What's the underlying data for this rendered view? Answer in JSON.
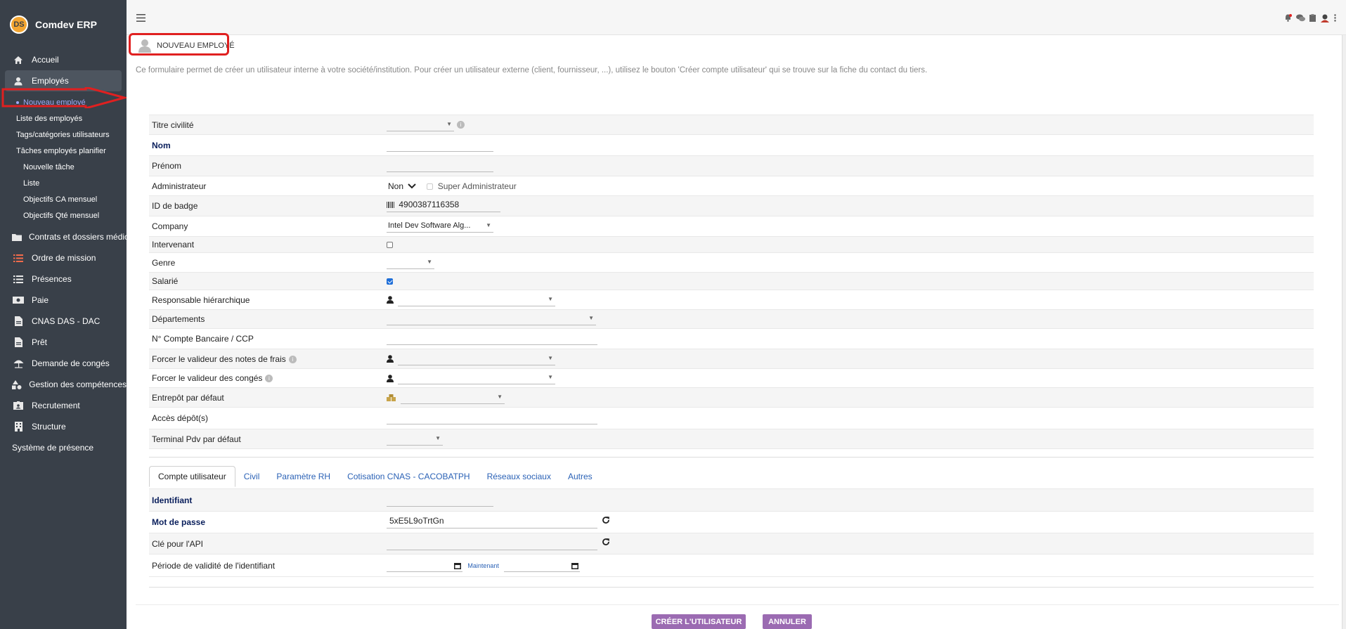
{
  "app": {
    "name": "Comdev ERP",
    "logo_text": "DS"
  },
  "sidebar": {
    "top_items": [
      {
        "label": "Accueil",
        "icon": "home-icon"
      },
      {
        "label": "Employés",
        "icon": "user-icon"
      }
    ],
    "employee_sub": {
      "current": "Nouveau employé",
      "items": [
        "Liste des employés",
        "Tags/catégories utilisateurs",
        "Tâches employés planifier"
      ],
      "lvl2": [
        "Nouvelle tâche",
        "Liste",
        "Objectifs CA mensuel",
        "Objectifs Qté mensuel"
      ]
    },
    "items": [
      {
        "label": "Contrats et dossiers médic",
        "icon": "folder-icon"
      },
      {
        "label": "Ordre de mission",
        "icon": "list-icon"
      },
      {
        "label": "Présences",
        "icon": "list-icon"
      },
      {
        "label": "Paie",
        "icon": "money-icon"
      },
      {
        "label": "CNAS DAS - DAC",
        "icon": "file-icon"
      },
      {
        "label": "Prêt",
        "icon": "file-icon"
      },
      {
        "label": "Demande de congés",
        "icon": "umbrella-icon"
      },
      {
        "label": "Gestion des compétences",
        "icon": "shapes-icon"
      },
      {
        "label": "Recrutement",
        "icon": "id-card-icon"
      },
      {
        "label": "Structure",
        "icon": "building-icon"
      }
    ],
    "bottom_item": "Système de présence"
  },
  "page": {
    "title": "NOUVEAU EMPLOYÉ",
    "description": "Ce formulaire permet de créer un utilisateur interne à votre société/institution. Pour créer un utilisateur externe (client, fournisseur, ...), utilisez le bouton 'Créer compte utilisateur' qui se trouve sur la fiche du contact du tiers."
  },
  "form": {
    "titre_civilite": "Titre civilité",
    "nom": "Nom",
    "prenom": "Prénom",
    "administrateur": "Administrateur",
    "administrateur_value": "Non",
    "super_admin": "Super Administrateur",
    "badge": "ID de badge",
    "badge_value": "4900387116358",
    "company": "Company",
    "company_value": "Intel Dev Software Alg...",
    "intervenant": "Intervenant",
    "genre": "Genre",
    "salarie": "Salarié",
    "responsable": "Responsable hiérarchique",
    "departements": "Départements",
    "compte_bancaire": "N° Compte Bancaire / CCP",
    "valideur_frais": "Forcer le valideur des notes de frais",
    "valideur_conges": "Forcer le valideur des congés",
    "entrepot": "Entrepôt par défaut",
    "acces_depots": "Accès dépôt(s)",
    "terminal_pdv": "Terminal Pdv par défaut"
  },
  "tabs": [
    "Compte utilisateur",
    "Civil",
    "Paramètre RH",
    "Cotisation CNAS - CACOBATPH",
    "Réseaux sociaux",
    "Autres"
  ],
  "account": {
    "identifiant": "Identifiant",
    "mot_de_passe": "Mot de passe",
    "mot_de_passe_value": "5xE5L9oTrtGn",
    "cle_api": "Clé pour l'API",
    "periode": "Période de validité de l'identifiant",
    "maintenant": "Maintenant"
  },
  "buttons": {
    "create": "CRÉER L'UTILISATEUR",
    "cancel": "ANNULER"
  },
  "colors": {
    "sidebar": "#394049",
    "accent": "#9b6bb2",
    "link": "#2b62b6",
    "annotation": "#e02020"
  }
}
